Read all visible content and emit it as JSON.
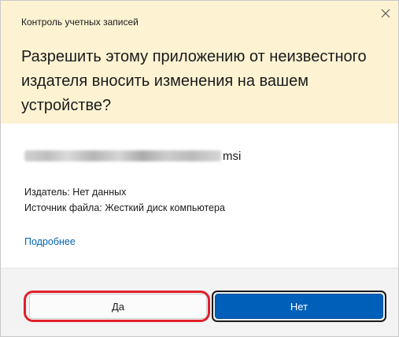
{
  "dialog": {
    "caption": "Контроль учетных записей",
    "question": "Разрешить этому приложению от неизвестного издателя вносить изменения на вашем устройстве?",
    "file": {
      "name_visible_suffix": "msi"
    },
    "publisher_line": "Издатель: Нет данных",
    "source_line": "Источник файла: Жесткий диск компьютера",
    "more_link": "Подробнее",
    "buttons": {
      "yes": "Да",
      "no": "Нет"
    }
  },
  "colors": {
    "header_bg": "#fdf3d3",
    "footer_bg": "#f3f3f3",
    "primary_button": "#005fb8",
    "link": "#0063b1",
    "highlight": "#e0202a"
  },
  "icons": {
    "close": "close-icon"
  }
}
